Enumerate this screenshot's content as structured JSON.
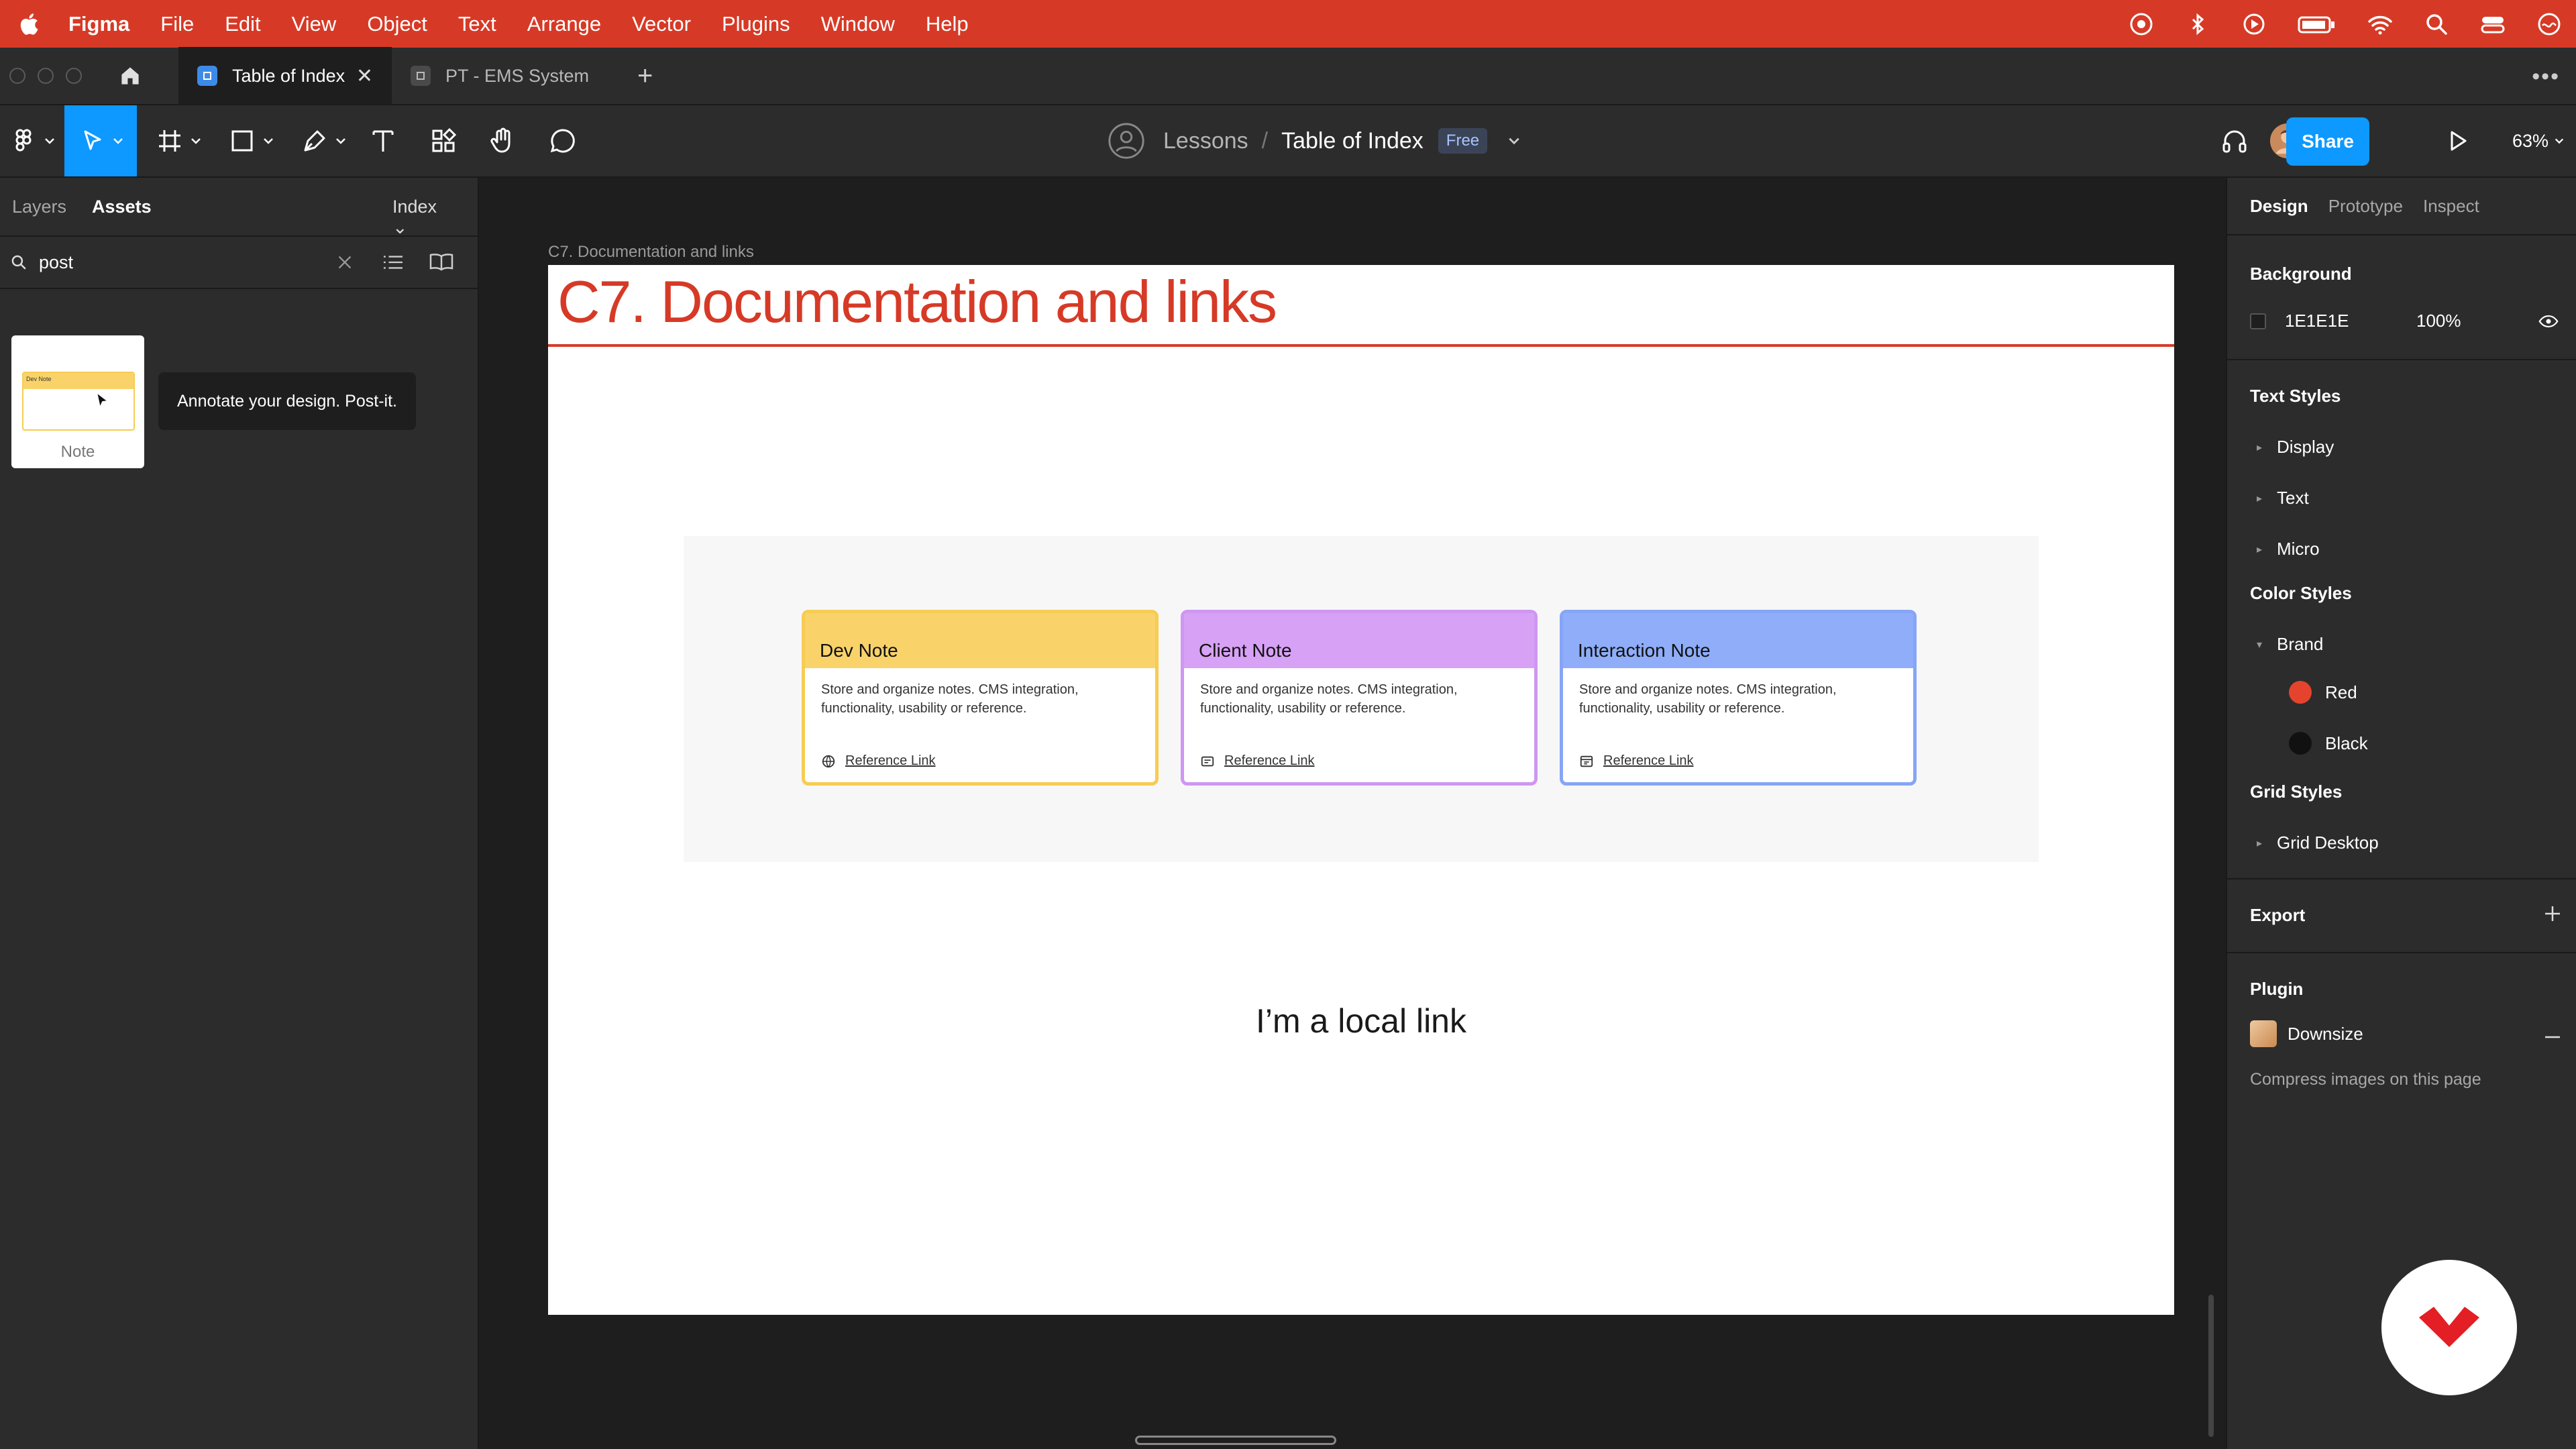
{
  "menubar": {
    "app_name": "Figma",
    "items": [
      "File",
      "Edit",
      "View",
      "Object",
      "Text",
      "Arrange",
      "Vector",
      "Plugins",
      "Window",
      "Help"
    ]
  },
  "tabs": [
    {
      "label": "Table of Index",
      "active": true
    },
    {
      "label": "PT - EMS System",
      "active": false
    }
  ],
  "toolbar": {
    "breadcrumb_project": "Lessons",
    "breadcrumb_separator": "/",
    "breadcrumb_file": "Table of Index",
    "plan_badge": "Free",
    "share_label": "Share",
    "zoom_level": "63%"
  },
  "left_panel": {
    "tab_layers": "Layers",
    "tab_assets": "Assets",
    "page_selector": "Index",
    "search_value": "post",
    "asset": {
      "label": "Note",
      "thumb_title": "Dev Note"
    },
    "tooltip": "Annotate your design. Post-it."
  },
  "canvas": {
    "frame_label": "C7. Documentation and links",
    "frame_title": "C7.  Documentation and links",
    "notes": [
      {
        "title": "Dev Note",
        "body": "Store and organize notes. CMS integration, functionality, usability or reference.",
        "link": "Reference Link",
        "header_color": "#f9d36a",
        "border_color": "#f7cc52"
      },
      {
        "title": "Client Note",
        "body": "Store and organize notes. CMS integration, functionality, usability or reference.",
        "link": "Reference Link",
        "header_color": "#d7a1f5",
        "border_color": "#cf96f2"
      },
      {
        "title": "Interaction Note",
        "body": "Store and organize notes. CMS integration, functionality, usability or reference.",
        "link": "Reference Link",
        "header_color": "#8fadf8",
        "border_color": "#86a5f6"
      }
    ],
    "local_link_text": "I’m a local link"
  },
  "right_panel": {
    "tab_design": "Design",
    "tab_prototype": "Prototype",
    "tab_inspect": "Inspect",
    "background_title": "Background",
    "background_hex": "1E1E1E",
    "background_opacity": "100%",
    "text_styles_title": "Text Styles",
    "text_styles": [
      "Display",
      "Text",
      "Micro"
    ],
    "color_styles_title": "Color Styles",
    "color_group": "Brand",
    "colors": [
      {
        "name": "Red",
        "hex": "#e5432d"
      },
      {
        "name": "Black",
        "hex": "#111111"
      }
    ],
    "grid_styles_title": "Grid Styles",
    "grid_style": "Grid Desktop",
    "export_title": "Export",
    "plugin_title": "Plugin",
    "plugin_name": "Downsize",
    "plugin_desc": "Compress images on this page"
  },
  "colors": {
    "accent": "#0d99ff",
    "brand_red": "#d63a26"
  }
}
